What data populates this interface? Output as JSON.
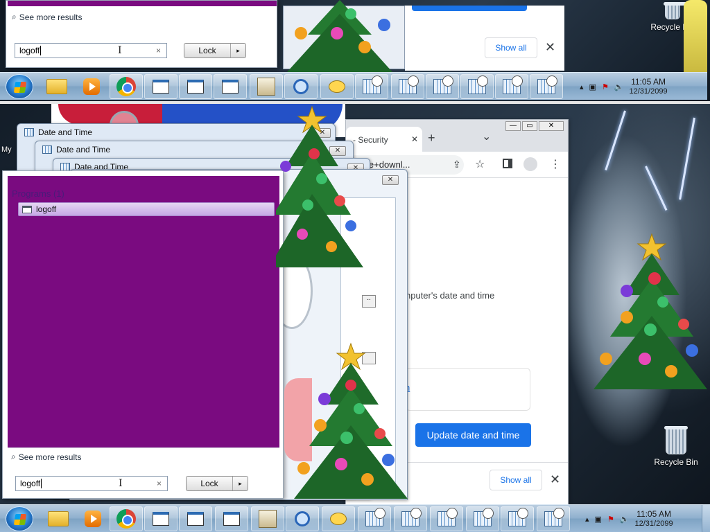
{
  "desktop": {
    "recycle_bin_label": "Recycle Bin",
    "partial_icon_label": "My"
  },
  "start_menu": {
    "programs_header": "Programs (1)",
    "program_item": "logoff",
    "see_more": "See more results",
    "search_value": "logoff",
    "search_clear": "×",
    "lock_label": "Lock",
    "lock_arrow": "▸"
  },
  "date_time_windows": {
    "title": "Date and Time",
    "close_glyph": "✕"
  },
  "browser": {
    "tab_title": "- Security",
    "tab_close": "✕",
    "new_tab": "+",
    "tab_list": "⌄",
    "address_text": "theme+downl...",
    "page_text": "nputer's date and time",
    "update_button": "Update date and time",
    "link_fragment": "n",
    "download_show_all": "Show all",
    "download_close": "✕",
    "window_minimize": "—",
    "window_restore": "▭",
    "window_close": "✕"
  },
  "taskbar": {
    "time": "11:05 AM",
    "date": "12/31/2099"
  }
}
